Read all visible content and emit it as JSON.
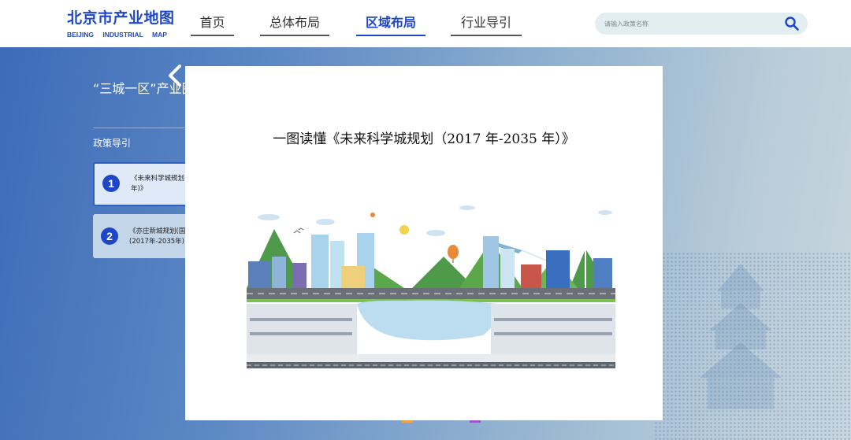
{
  "header": {
    "logo_cn": "北京市产业地图",
    "logo_en": "BEIJING INDUSTRIAL MAP",
    "nav": [
      {
        "label": "首页",
        "active": false
      },
      {
        "label": "总体布局",
        "active": false
      },
      {
        "label": "区域布局",
        "active": true
      },
      {
        "label": "行业导引",
        "active": false
      }
    ],
    "search_placeholder": "请输入政策名称"
  },
  "sidebar": {
    "title": "“三城一区”产业图",
    "subtitle": "政策导引",
    "items": [
      {
        "number": "1",
        "text_line1": "《未来科学城规划",
        "text_line2": "年)》"
      },
      {
        "number": "2",
        "text_line1": "《亦庄新城规划(国",
        "text_line2": "(2017年-2035年)"
      }
    ]
  },
  "modal": {
    "title": "一图读懂《未来科学城规划（2017 年-2035 年）》"
  },
  "colors": {
    "brand": "#1d46c8",
    "accent_green": "#5aa84a"
  },
  "icons": [
    "search-icon",
    "chevron-left-icon"
  ]
}
